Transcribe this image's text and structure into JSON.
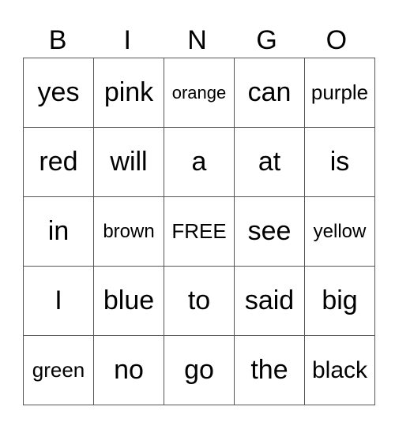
{
  "header": [
    "B",
    "I",
    "N",
    "G",
    "O"
  ],
  "rows": [
    [
      "yes",
      "pink",
      "orange",
      "can",
      "purple"
    ],
    [
      "red",
      "will",
      "a",
      "at",
      "is"
    ],
    [
      "in",
      "brown",
      "FREE",
      "see",
      "yellow"
    ],
    [
      "I",
      "blue",
      "to",
      "said",
      "big"
    ],
    [
      "green",
      "no",
      "go",
      "the",
      "black"
    ]
  ]
}
